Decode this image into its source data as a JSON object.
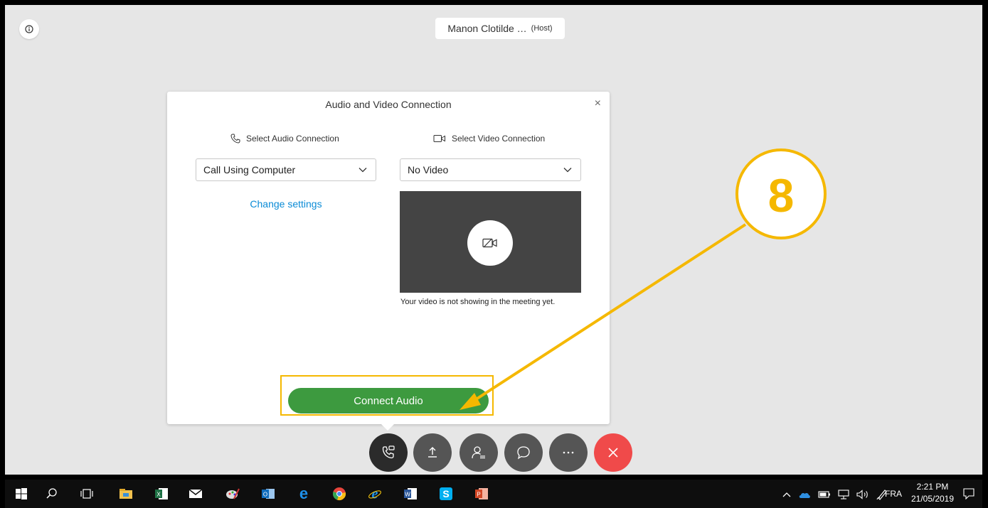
{
  "meeting": {
    "host_name": "Manon Clotilde …",
    "host_tag": "(Host)"
  },
  "dialog": {
    "title": "Audio and Video Connection",
    "close": "×",
    "audio_heading": "Select Audio Connection",
    "video_heading": "Select Video Connection",
    "audio_select_value": "Call Using Computer",
    "video_select_value": "No Video",
    "change_settings": "Change settings",
    "preview_note": "Your video is not showing in the meeting yet.",
    "connect_button": "Connect Audio"
  },
  "annotation": {
    "step_number": "8",
    "color": "#f5b800"
  },
  "controls": [
    {
      "name": "audio-connection-icon"
    },
    {
      "name": "share-icon"
    },
    {
      "name": "participants-icon"
    },
    {
      "name": "chat-icon"
    },
    {
      "name": "more-icon"
    },
    {
      "name": "leave-icon"
    }
  ],
  "taskbar": {
    "language": "FRA",
    "time": "2:21 PM",
    "date": "21/05/2019",
    "pinned": [
      "start-icon",
      "search-icon",
      "task-view-icon",
      "file-explorer-icon",
      "excel-icon",
      "mail-icon",
      "paint-icon",
      "outlook-icon",
      "edge-icon",
      "chrome-icon",
      "internet-explorer-icon",
      "word-icon",
      "skype-icon",
      "powerpoint-icon"
    ]
  },
  "colors": {
    "accent_green": "#3d9a3f",
    "link_blue": "#0a8bd6",
    "leave_red": "#f04a4a",
    "control_dark": "#555555"
  }
}
